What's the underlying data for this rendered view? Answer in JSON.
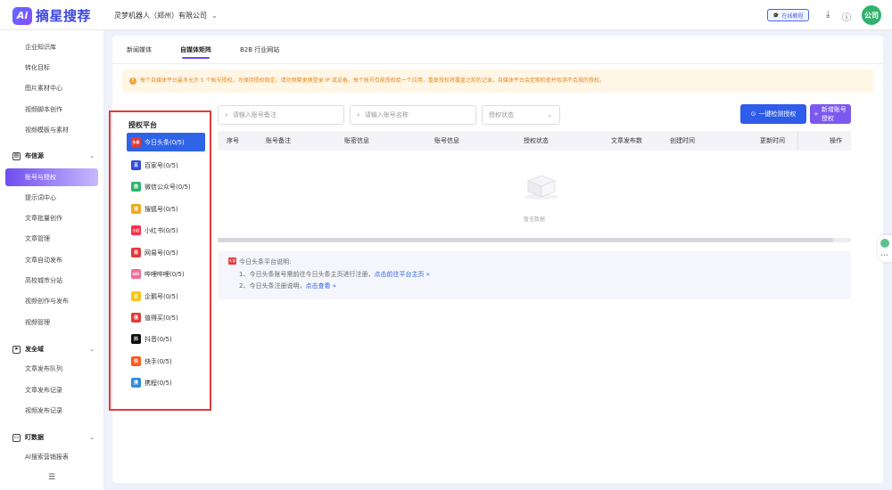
{
  "brand": {
    "logo_mark": "Ai",
    "name": "摘星搜荐"
  },
  "header": {
    "company": "灵梦机器人（郑州）有限公司",
    "tutorial_label": "在线教程",
    "avatar_text": "公司"
  },
  "sidebar": {
    "items_top": [
      "企业知识库",
      "转化目标",
      "图片素材中心",
      "视频脚本创作",
      "视频模板与素材"
    ],
    "group1": "布信源",
    "active_item": "账号与授权",
    "items_mid": [
      "提示词中心",
      "文章批量创作",
      "文章管理",
      "文章自动发布",
      "高校城市分站",
      "视频创作与发布",
      "视频管理"
    ],
    "group2": "发全域",
    "items_g2": [
      "文章发布队列",
      "文章发布记录",
      "视频发布记录"
    ],
    "group3": "盯数据",
    "items_g3": [
      "AI搜索营销报表"
    ]
  },
  "tabs": [
    "新闻媒体",
    "自媒体矩阵",
    "B2B 行业网站"
  ],
  "active_tab": "自媒体矩阵",
  "notice": "每个自媒体平台最多允许 5 个账号授权。为保持授权稳定，请勿频繁更换登录 IP 或设备。每个账号仅能授权给一个应用，重复授权将覆盖之前的记录。自媒体平台会定期检查并取消不合规的授权。",
  "platform_panel": {
    "title": "授权平台",
    "platforms": [
      {
        "label": "今日头条(0/5)",
        "icon": "toutiao-icon",
        "badge": "头条",
        "color": "#e23a3a"
      },
      {
        "label": "百家号(0/5)",
        "icon": "baijiahao-icon",
        "badge": "百",
        "color": "#2f4bd8"
      },
      {
        "label": "微信公众号(0/5)",
        "icon": "wechat-icon",
        "badge": "微",
        "color": "#2fb36d"
      },
      {
        "label": "搜狐号(0/5)",
        "icon": "sohu-icon",
        "badge": "搜",
        "color": "#f0a81c"
      },
      {
        "label": "小红书(0/5)",
        "icon": "xiaohongshu-icon",
        "badge": "小红",
        "color": "#ff2d4a"
      },
      {
        "label": "网易号(0/5)",
        "icon": "netease-icon",
        "badge": "易",
        "color": "#e2383a"
      },
      {
        "label": "哔哩哔哩(0/5)",
        "icon": "bilibili-icon",
        "badge": "bili",
        "color": "#f06d9a"
      },
      {
        "label": "企鹅号(0/5)",
        "icon": "penguin-icon",
        "badge": "企",
        "color": "#f7c61a"
      },
      {
        "label": "值得买(0/5)",
        "icon": "zhidemai-icon",
        "badge": "值",
        "color": "#e23a3a"
      },
      {
        "label": "抖音(0/5)",
        "icon": "douyin-icon",
        "badge": "抖",
        "color": "#111111"
      },
      {
        "label": "快手(0/5)",
        "icon": "kuaishou-icon",
        "badge": "快",
        "color": "#ff5a1f"
      },
      {
        "label": "携程(0/5)",
        "icon": "ctrip-icon",
        "badge": "携",
        "color": "#2f8bd8"
      }
    ]
  },
  "filters": {
    "remark_placeholder": "请输入账号备注",
    "name_placeholder": "请输入账号名称",
    "status_placeholder": "授权状态"
  },
  "buttons": {
    "check": "一键检测授权",
    "add": "新增账号授权"
  },
  "table": {
    "columns": [
      "序号",
      "账号备注",
      "账密信息",
      "账号信息",
      "授权状态",
      "文章发布数",
      "创建时间",
      "更新时间",
      "操作"
    ],
    "empty_text": "暂无数据"
  },
  "tips": {
    "title": "今日头条平台说明:",
    "line1": "1、今日头条账号需前往今日头条主页进行注册，",
    "line1_link": "点击前往平台主页 »",
    "line2": "2、今日头条注册说明，",
    "line2_link": "点击查看 »"
  }
}
